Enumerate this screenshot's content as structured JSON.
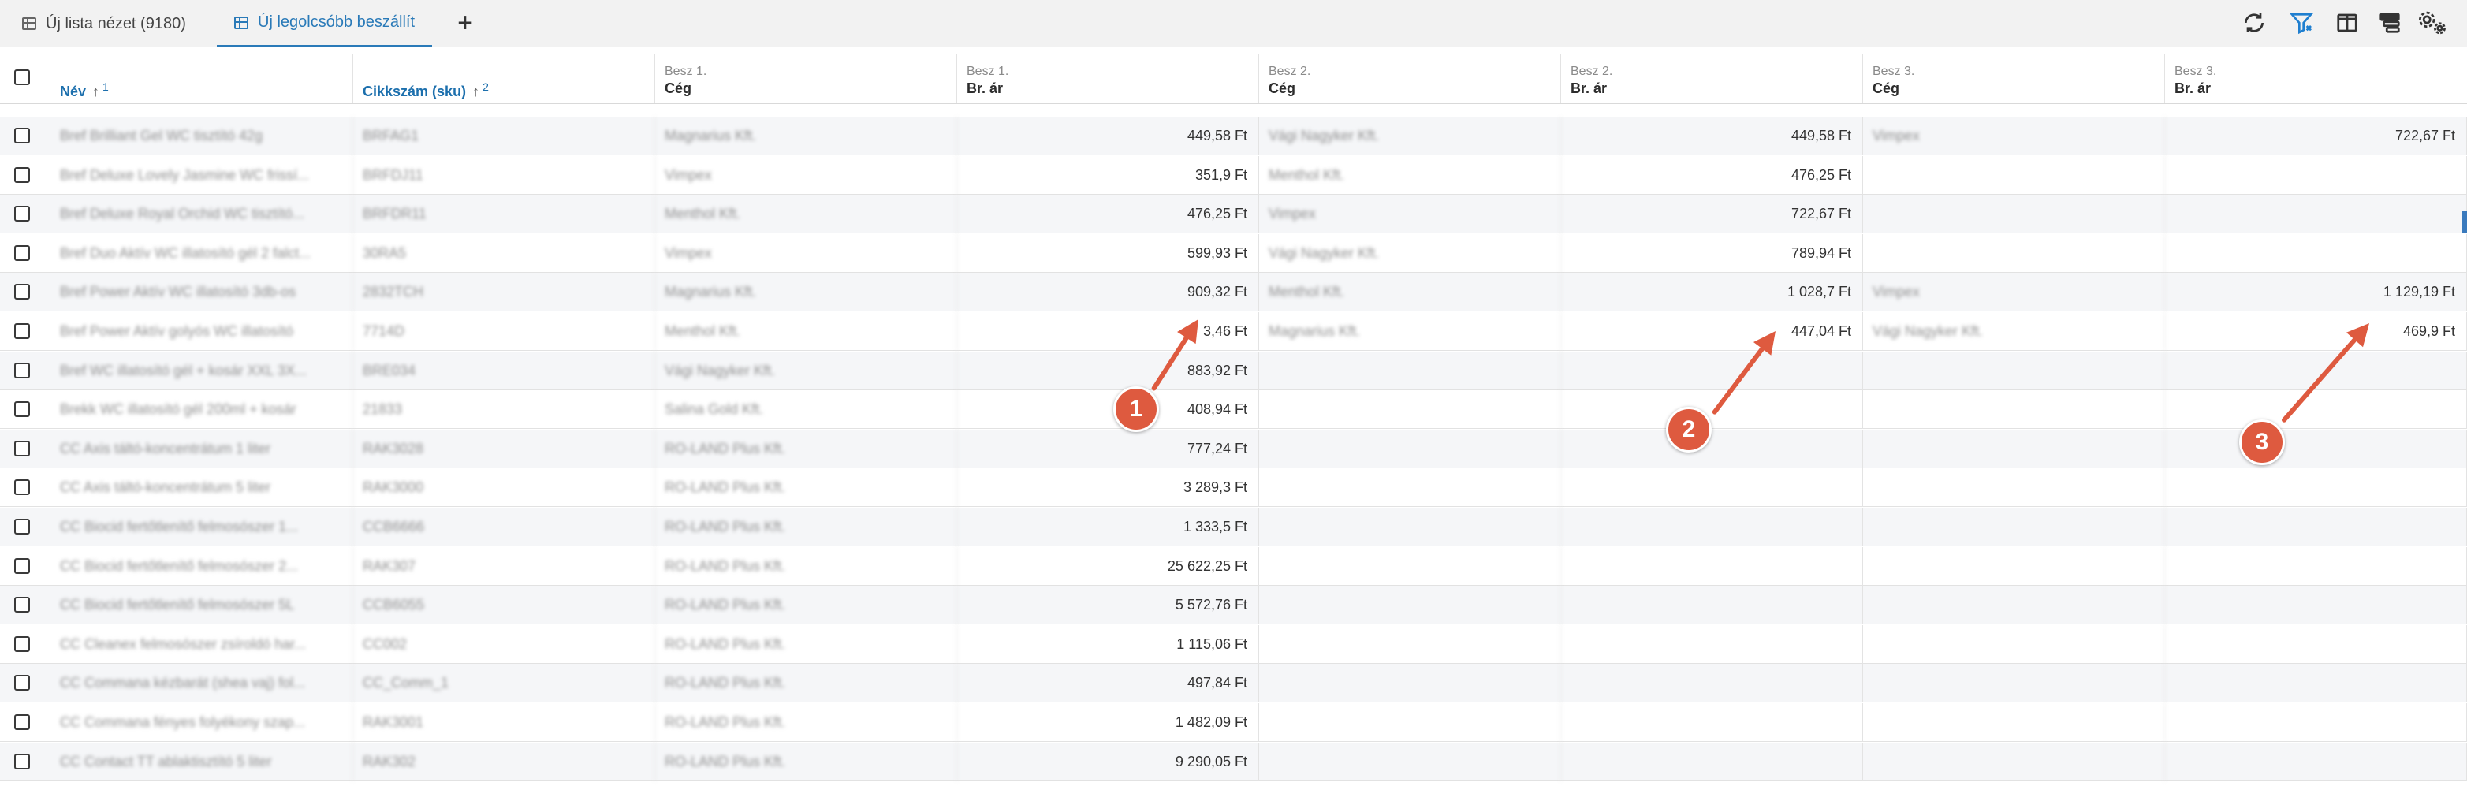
{
  "tabs": [
    {
      "label": "Új lista nézet (9180)",
      "active": false
    },
    {
      "label": "Új legolcsóbb beszállít",
      "active": true
    }
  ],
  "toolbar": {
    "add_tab": "+",
    "icons": [
      "refresh-icon",
      "filter-icon",
      "columns-icon",
      "stack-icon",
      "settings-icon"
    ]
  },
  "columns": [
    {
      "sub": "",
      "title": "Név",
      "sort_index": "1",
      "sort_dir": "↑",
      "sortable": true
    },
    {
      "sub": "",
      "title": "Cikkszám (sku)",
      "sort_index": "2",
      "sort_dir": "↑",
      "sortable": true
    },
    {
      "sub": "Besz 1.",
      "title": "Cég"
    },
    {
      "sub": "Besz 1.",
      "title": "Br. ár"
    },
    {
      "sub": "Besz 2.",
      "title": "Cég"
    },
    {
      "sub": "Besz 2.",
      "title": "Br. ár"
    },
    {
      "sub": "Besz 3.",
      "title": "Cég"
    },
    {
      "sub": "Besz 3.",
      "title": "Br. ár"
    }
  ],
  "rows": [
    {
      "name": "Bref Brilliant Gel WC tisztító 42g",
      "sku": "BRFAG1",
      "c1": "Magnarius Kft.",
      "p1": "449,58 Ft",
      "c2": "Vági Nagyker Kft.",
      "p2": "449,58 Ft",
      "c3": "Vimpex",
      "p3": "722,67 Ft"
    },
    {
      "name": "Bref Deluxe Lovely Jasmine WC frissí...",
      "sku": "BRFDJ11",
      "c1": "Vimpex",
      "p1": "351,9 Ft",
      "c2": "Menthol Kft.",
      "p2": "476,25 Ft",
      "c3": "",
      "p3": ""
    },
    {
      "name": "Bref Deluxe Royal Orchid WC tisztító...",
      "sku": "BRFDR11",
      "c1": "Menthol Kft.",
      "p1": "476,25 Ft",
      "c2": "Vimpex",
      "p2": "722,67 Ft",
      "c3": "",
      "p3": ""
    },
    {
      "name": "Bref Duo Aktív WC illatosító gél 2 falct...",
      "sku": "30RA5",
      "c1": "Vimpex",
      "p1": "599,93 Ft",
      "c2": "Vági Nagyker Kft.",
      "p2": "789,94 Ft",
      "c3": "",
      "p3": ""
    },
    {
      "name": "Bref Power Aktív WC illatosító 3db-os",
      "sku": "2832TCH",
      "c1": "Magnarius Kft.",
      "p1": "909,32 Ft",
      "c2": "Menthol Kft.",
      "p2": "1 028,7 Ft",
      "c3": "Vimpex",
      "p3": "1 129,19 Ft"
    },
    {
      "name": "Bref Power Aktív golyós WC illatosító",
      "sku": "7714D",
      "c1": "Menthol Kft.",
      "p1": "3,46 Ft",
      "c2": "Magnarius Kft.",
      "p2": "447,04 Ft",
      "c3": "Vági Nagyker Kft.",
      "p3": "469,9 Ft"
    },
    {
      "name": "Bref WC illatosító gél + kosár XXL 3X...",
      "sku": "BRE034",
      "c1": "Vági Nagyker Kft.",
      "p1": "883,92 Ft",
      "c2": "",
      "p2": "",
      "c3": "",
      "p3": ""
    },
    {
      "name": "Brekk WC illatosító gél 200ml + kosár",
      "sku": "21833",
      "c1": "Salina Gold Kft.",
      "p1": "408,94 Ft",
      "c2": "",
      "p2": "",
      "c3": "",
      "p3": ""
    },
    {
      "name": "CC Axis táltó-koncentrátum 1 liter",
      "sku": "RAK3028",
      "c1": "RO-LAND Plus Kft.",
      "p1": "777,24 Ft",
      "c2": "",
      "p2": "",
      "c3": "",
      "p3": ""
    },
    {
      "name": "CC Axis táltó-koncentrátum 5 liter",
      "sku": "RAK3000",
      "c1": "RO-LAND Plus Kft.",
      "p1": "3 289,3 Ft",
      "c2": "",
      "p2": "",
      "c3": "",
      "p3": ""
    },
    {
      "name": "CC Biocid fertőtlenítő felmosószer 1...",
      "sku": "CCB6666",
      "c1": "RO-LAND Plus Kft.",
      "p1": "1 333,5 Ft",
      "c2": "",
      "p2": "",
      "c3": "",
      "p3": ""
    },
    {
      "name": "CC Biocid fertőtlenítő felmosószer 2...",
      "sku": "RAK307",
      "c1": "RO-LAND Plus Kft.",
      "p1": "25 622,25 Ft",
      "c2": "",
      "p2": "",
      "c3": "",
      "p3": ""
    },
    {
      "name": "CC Biocid fertőtlenítő felmosószer 5L",
      "sku": "CCB6055",
      "c1": "RO-LAND Plus Kft.",
      "p1": "5 572,76 Ft",
      "c2": "",
      "p2": "",
      "c3": "",
      "p3": ""
    },
    {
      "name": "CC Cleanex felmosószer zsíroldó har...",
      "sku": "CC002",
      "c1": "RO-LAND Plus Kft.",
      "p1": "1 115,06 Ft",
      "c2": "",
      "p2": "",
      "c3": "",
      "p3": ""
    },
    {
      "name": "CC Commana kézbarát (shea vaj) fol...",
      "sku": "CC_Comm_1",
      "c1": "RO-LAND Plus Kft.",
      "p1": "497,84 Ft",
      "c2": "",
      "p2": "",
      "c3": "",
      "p3": ""
    },
    {
      "name": "CC Commana fényes folyékony szap...",
      "sku": "RAK3001",
      "c1": "RO-LAND Plus Kft.",
      "p1": "1 482,09 Ft",
      "c2": "",
      "p2": "",
      "c3": "",
      "p3": ""
    },
    {
      "name": "CC Contact TT ablaktisztító 5 liter",
      "sku": "RAK302",
      "c1": "RO-LAND Plus Kft.",
      "p1": "9 290,05 Ft",
      "c2": "",
      "p2": "",
      "c3": "",
      "p3": ""
    }
  ],
  "annotations": [
    {
      "label": "1",
      "color": "#de5a3f"
    },
    {
      "label": "2",
      "color": "#de5a3f"
    },
    {
      "label": "3",
      "color": "#de5a3f"
    }
  ]
}
